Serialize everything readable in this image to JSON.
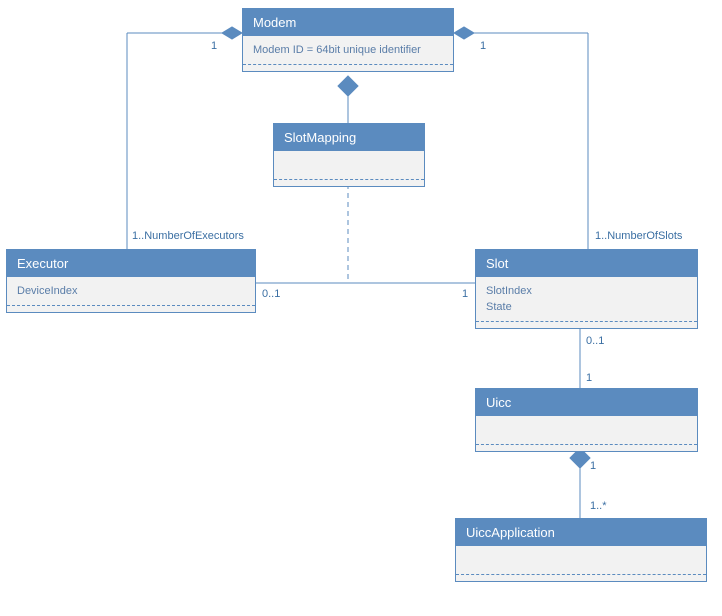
{
  "diagram": {
    "modem": {
      "title": "Modem",
      "attr1": "Modem ID = 64bit unique identifier"
    },
    "slotmapping": {
      "title": "SlotMapping"
    },
    "executor": {
      "title": "Executor",
      "attr1": "DeviceIndex"
    },
    "slot": {
      "title": "Slot",
      "attr1": "SlotIndex",
      "attr2": "State"
    },
    "uicc": {
      "title": "Uicc"
    },
    "uiccapp": {
      "title": "UiccApplication"
    }
  },
  "multiplicities": {
    "modem_exec_top": "1",
    "modem_exec_bottom": "1..NumberOfExecutors",
    "modem_slot_top": "1",
    "modem_slot_bottom": "1..NumberOfSlots",
    "exec_slot_left": "0..1",
    "exec_slot_right": "1",
    "slot_uicc_top": "0..1",
    "slot_uicc_bottom": "1",
    "uicc_app_top": "1",
    "uicc_app_bottom": "1..*"
  }
}
